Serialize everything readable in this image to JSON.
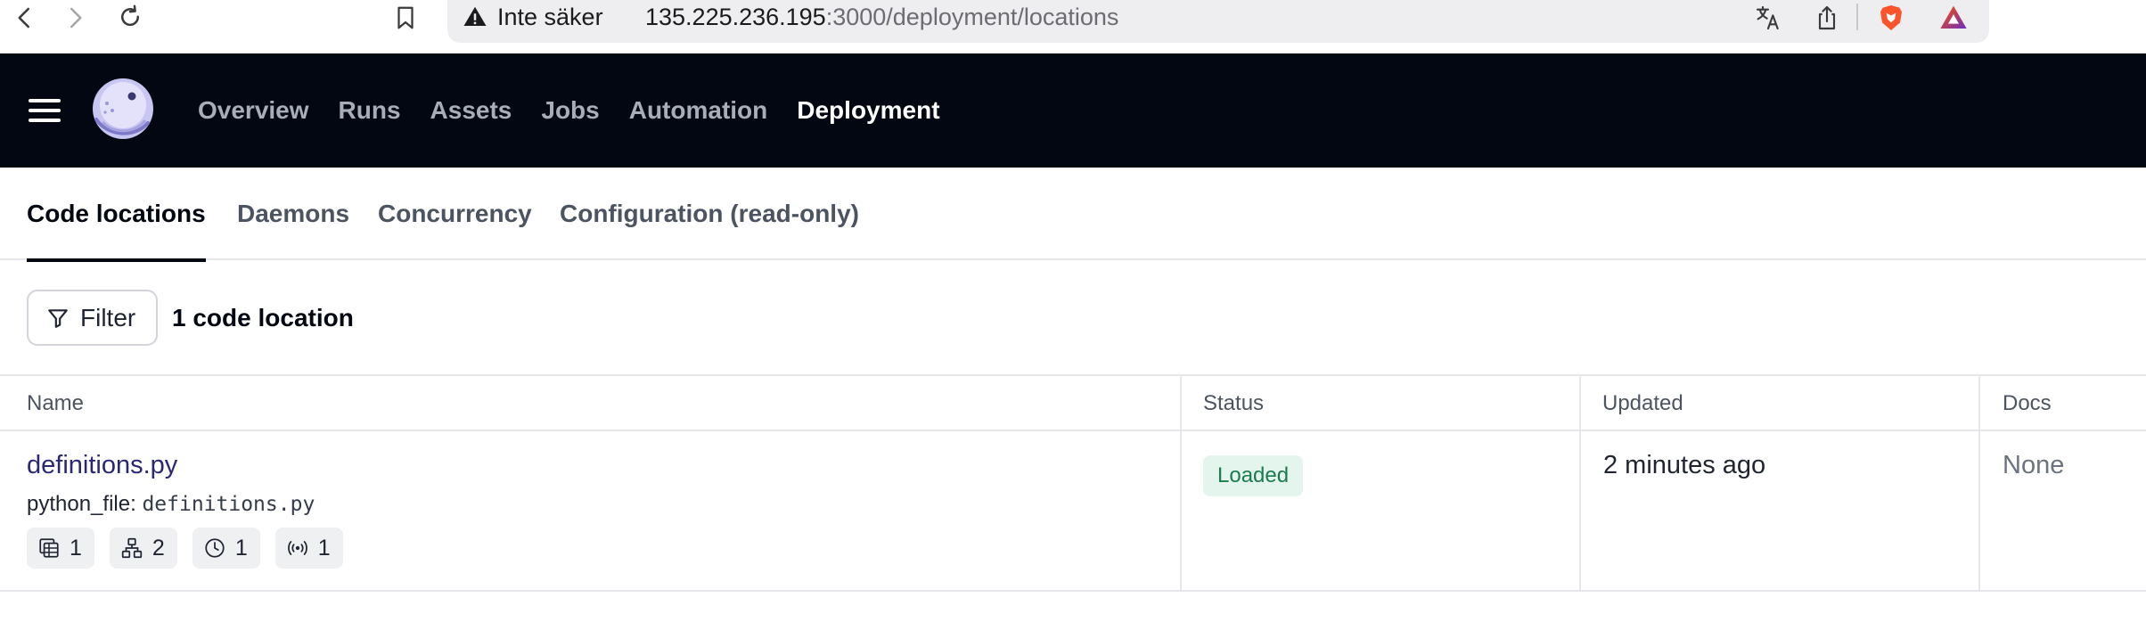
{
  "browser": {
    "security_label": "Inte säker",
    "url_host": "135.225.236.195",
    "url_path": ":3000/deployment/locations"
  },
  "app": {
    "nav": [
      {
        "label": "Overview",
        "active": false
      },
      {
        "label": "Runs",
        "active": false
      },
      {
        "label": "Assets",
        "active": false
      },
      {
        "label": "Jobs",
        "active": false
      },
      {
        "label": "Automation",
        "active": false
      },
      {
        "label": "Deployment",
        "active": true
      }
    ]
  },
  "tabs": [
    {
      "label": "Code locations",
      "active": true
    },
    {
      "label": "Daemons",
      "active": false
    },
    {
      "label": "Concurrency",
      "active": false
    },
    {
      "label": "Configuration (read-only)",
      "active": false
    }
  ],
  "toolbar": {
    "filter_label": "Filter",
    "count_label": "1 code location"
  },
  "table": {
    "headers": {
      "name": "Name",
      "status": "Status",
      "updated": "Updated",
      "docs": "Docs"
    },
    "rows": [
      {
        "name": "definitions.py",
        "source_key": "python_file:",
        "source_value": "definitions.py",
        "chips": [
          {
            "icon": "asset-table-icon",
            "count": "1"
          },
          {
            "icon": "job-graph-icon",
            "count": "2"
          },
          {
            "icon": "schedule-clock-icon",
            "count": "1"
          },
          {
            "icon": "sensor-icon",
            "count": "1"
          }
        ],
        "status": "Loaded",
        "updated": "2 minutes ago",
        "docs": "None"
      }
    ]
  },
  "colors": {
    "header_bg": "#030711",
    "link": "#2b2775",
    "status_bg": "#e3f5ec",
    "status_text": "#1b7c4e",
    "brave": "#fb542b"
  }
}
